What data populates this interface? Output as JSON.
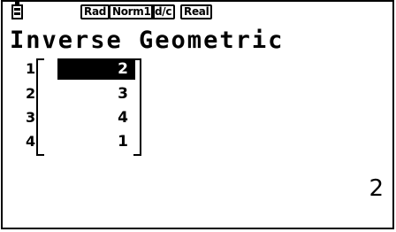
{
  "status_bar": {
    "battery_icon": "battery-icon",
    "angle_mode": "Rad",
    "display_mode": "Norm1",
    "fraction_mode": "d/c",
    "complex_mode": "Real"
  },
  "title": "Inverse Geometric",
  "matrix": {
    "row_indices": [
      "1",
      "2",
      "3",
      "4"
    ],
    "values": [
      "2",
      "3",
      "4",
      "1"
    ],
    "selected_row": 1
  },
  "result": "2"
}
